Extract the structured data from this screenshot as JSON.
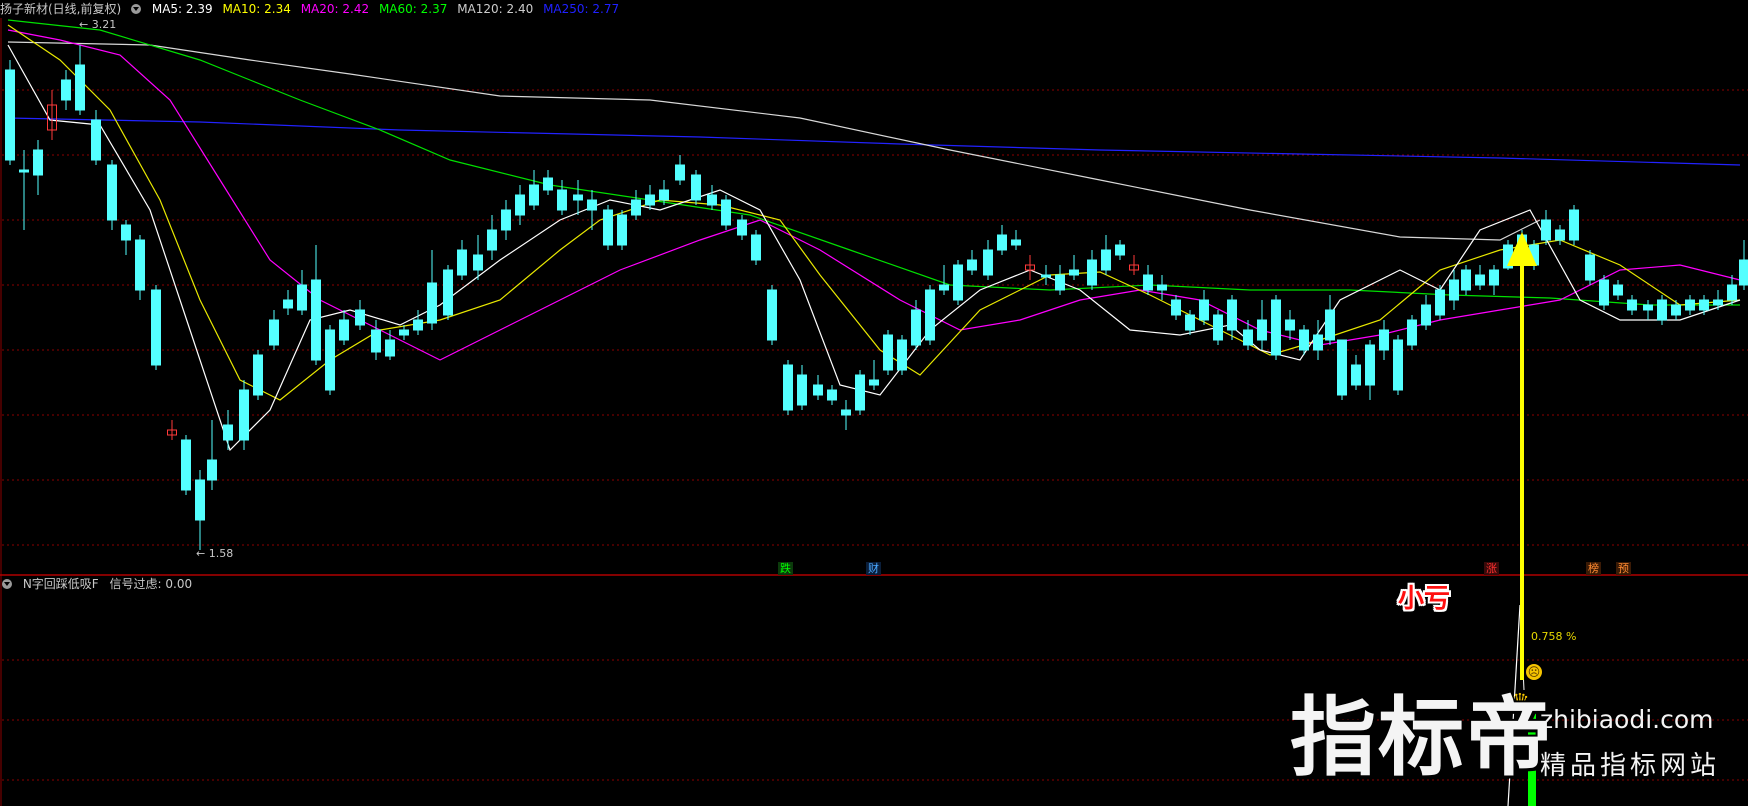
{
  "header": {
    "stock_title": "扬子新材(日线,前复权)",
    "ma_items": [
      {
        "label": "MA5: 2.39",
        "color": "#ffffff"
      },
      {
        "label": "MA10: 2.34",
        "color": "#ffff00"
      },
      {
        "label": "MA20: 2.42",
        "color": "#ff00ff"
      },
      {
        "label": "MA60: 2.37",
        "color": "#00ff00"
      },
      {
        "label": "MA120: 2.40",
        "color": "#cccccc"
      },
      {
        "label": "MA250: 2.77",
        "color": "#0000ff"
      }
    ]
  },
  "price_labels": {
    "high": "3.21",
    "low": "1.58"
  },
  "signal_tags": [
    {
      "label": "跌",
      "color": "#00ff00"
    },
    {
      "label": "财",
      "color": "#4aa8ff"
    },
    {
      "label": "涨",
      "color": "#ff3030"
    },
    {
      "label": "榜",
      "color": "#ff8a30"
    },
    {
      "label": "预",
      "color": "#ff8a30"
    }
  ],
  "sub_header": {
    "indicator_name": "N字回踩低吸F",
    "filter_label": "信号过虑: 0.00"
  },
  "annotation": {
    "text": "小亏",
    "percent": "0.758",
    "percent_unit": "%"
  },
  "watermark": {
    "brand": "指标帝",
    "url": "zhibiaodi.com",
    "slogan": "精品指标网站"
  },
  "colors": {
    "up": "#ff3a3a",
    "down": "#54ffff",
    "grid": "#8b0000",
    "arrow": "#ffff00",
    "signal_bar": "#00ff00"
  }
}
